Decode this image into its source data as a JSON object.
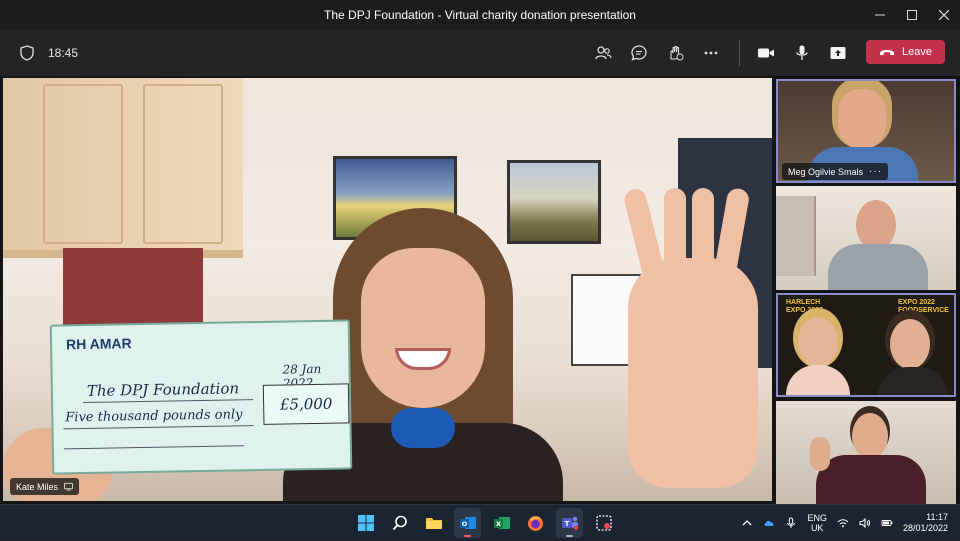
{
  "window": {
    "title": "The DPJ Foundation - Virtual charity donation presentation",
    "controls": [
      "minimize-icon",
      "maximize-icon",
      "close-icon"
    ]
  },
  "toolbar": {
    "time": "18:45",
    "icons": [
      "shield-icon",
      "people-icon",
      "chat-icon",
      "reactions-icon",
      "more-icon",
      "camera-icon",
      "mic-icon",
      "share-icon"
    ],
    "leave_label": "Leave",
    "leave_color": "#c4314b"
  },
  "main_video": {
    "participant": "Kate Miles",
    "cheque": {
      "bank": "RH AMAR",
      "date": "28 Jan 2022",
      "payee": "The DPJ Foundation",
      "amount_words": "Five thousand pounds only",
      "amount": "£5,000"
    }
  },
  "side_tiles": [
    {
      "participant": "Meg Ogilvie Smals",
      "active": true,
      "more": "···"
    },
    {
      "participant": "",
      "active": false
    },
    {
      "participant": "",
      "active": true,
      "banner": [
        "HARLECH",
        "EXPO 2022",
        "FOODSERVICE"
      ]
    },
    {
      "participant": "",
      "active": false
    }
  ],
  "accent_color": "#8b8cc7",
  "taskbar": {
    "apps": [
      "windows-start-icon",
      "search-icon",
      "file-explorer-icon",
      "outlook-icon",
      "excel-icon",
      "firefox-icon",
      "teams-icon",
      "snipping-tool-icon"
    ],
    "language_top": "ENG",
    "language_bottom": "UK",
    "time": "11:17",
    "date": "28/01/2022"
  }
}
